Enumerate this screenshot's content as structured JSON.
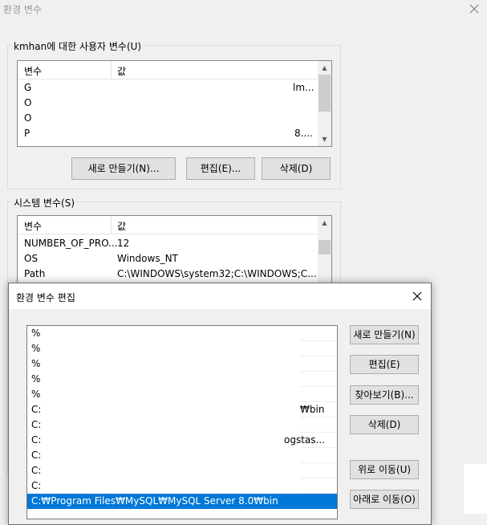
{
  "window": {
    "title": "환경 변수"
  },
  "user_vars": {
    "group_label": "kmhan에 대한 사용자 변수(U)",
    "col_var": "변수",
    "col_val": "값",
    "rows": [
      {
        "name": "G",
        "value": "lm..."
      },
      {
        "name": "O",
        "value": ""
      },
      {
        "name": "O",
        "value": ""
      },
      {
        "name": "P",
        "value": "8...."
      }
    ],
    "new_label": "새로 만들기(N)...",
    "edit_label": "편집(E)...",
    "delete_label": "삭제(D)"
  },
  "system_vars": {
    "group_label": "시스템 변수(S)",
    "col_var": "변수",
    "col_val": "값",
    "rows": [
      {
        "name": "NUMBER_OF_PRO...",
        "value": "12"
      },
      {
        "name": "OS",
        "value": "Windows_NT"
      },
      {
        "name": "Path",
        "value": "C:\\WINDOWS\\system32;C:\\WINDOWS;C..."
      }
    ]
  },
  "edit_dialog": {
    "title": "환경 변수 편집",
    "items": [
      {
        "text": "%",
        "tail": ""
      },
      {
        "text": "%",
        "tail": ""
      },
      {
        "text": "%",
        "tail": ""
      },
      {
        "text": "%",
        "tail": ""
      },
      {
        "text": "%",
        "tail": ""
      },
      {
        "text": "C:",
        "tail": "₩bin"
      },
      {
        "text": "C:",
        "tail": ""
      },
      {
        "text": "C:",
        "tail": "ogstas..."
      },
      {
        "text": "C:",
        "tail": ""
      },
      {
        "text": "C:",
        "tail": ""
      },
      {
        "text": "C:",
        "tail": ""
      },
      {
        "text": "C:₩Program Files₩MySQL₩MySQL Server 8.0₩bin",
        "tail": "",
        "selected": true
      }
    ],
    "buttons": {
      "new": "새로 만들기(N)",
      "edit": "편집(E)",
      "browse": "찾아보기(B)...",
      "delete": "삭제(D)",
      "move_up": "위로 이동(U)",
      "move_down": "아래로 이동(O)"
    }
  },
  "colors": {
    "selection": "#0078d7",
    "window_bg": "#f0f0f0"
  }
}
